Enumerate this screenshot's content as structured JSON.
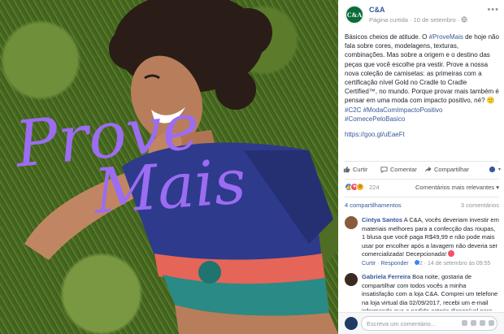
{
  "photo": {
    "overlay_text_line1": "Prove",
    "overlay_text_line2": "Mais",
    "overlay_color": "#9c6cf2",
    "shirt_color": "#2e3a8c",
    "grass_color": "#4a6b22"
  },
  "post": {
    "page_name": "C&A",
    "avatar_text": "C&A",
    "meta": "Página curtida · 10 de setembro ·",
    "more_icon": "more-horizontal-icon",
    "caption_parts": {
      "p1": "Básicos cheios de atitude. O ",
      "hashtag_prove": "#ProveMais",
      "p2": " de hoje não fala sobre cores, modelagens, texturas, combinações. Mas sobre a origem e o destino das peças que você escolhe pra vestir. Prove a nossa nova coleção de camisetas: as primeiras com a certificação nível Gold no Cradle to Cradle Certified™, no mundo. Porque provar mais também é pensar em uma moda com impacto positivo, né? ",
      "emoji": "🙂",
      "hashtag_c2c": "#C2C",
      "hashtag_moda": "#ModaComImpactoPositivo",
      "hashtag_comece": "#ComecePeloBasico",
      "url": "https://goo.gl/uEaeFt"
    }
  },
  "actions": {
    "like": "Curtir",
    "comment": "Comentar",
    "share": "Compartilhar",
    "audience_icon": "globe-icon"
  },
  "reactions": {
    "count": "224",
    "sort_label": "Comentários mais relevantes ▾"
  },
  "counts": {
    "shares": "4 compartilhamentos",
    "comments": "3 comentários"
  },
  "comments": [
    {
      "author": "Cintya Santos",
      "text": "A C&A, vocês deveriam investir em materiais melhores para a confecção das roupas, 1 blusa que você paga R$49,99 e não pode mais usar por encolher após a lavagem não deveria ser comercializada! Decepcionada!",
      "like": "Curtir",
      "reply": "Responder",
      "reactions": "2",
      "time": "14 de setembro às 09:55",
      "avatar_color": "#8a5a3c"
    },
    {
      "author": "Gabriela Ferreira",
      "text": "Boa noite, gostaria de compartilhar com todos vocês a minha insatisfação com a loja C&A. Comprei um telefone na loja virtual dia 02/09/2017, recebi um e-mail informando que o pedido estaria disponível para retirada na",
      "avatar_color": "#3b2a22"
    }
  ],
  "composer": {
    "placeholder": "Escreva um comentário..."
  }
}
